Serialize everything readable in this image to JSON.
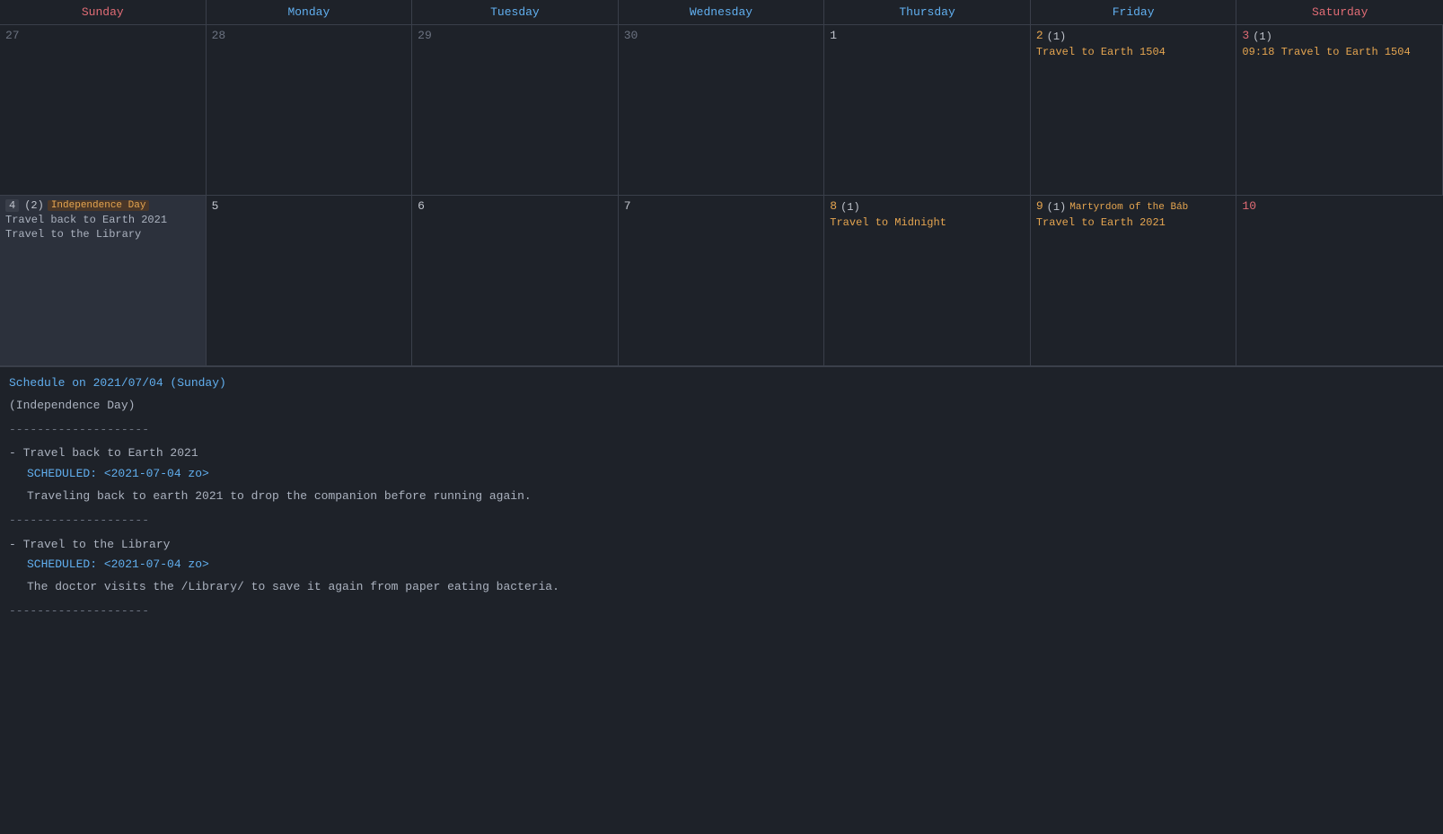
{
  "calendar": {
    "headers": [
      {
        "label": "Sunday",
        "class": "sun"
      },
      {
        "label": "Monday",
        "class": "mon"
      },
      {
        "label": "Tuesday",
        "class": "tue"
      },
      {
        "label": "Wednesday",
        "class": "wed"
      },
      {
        "label": "Thursday",
        "class": "thu"
      },
      {
        "label": "Friday",
        "class": "fri"
      },
      {
        "label": "Saturday",
        "class": "sat"
      }
    ],
    "weeks": [
      {
        "days": [
          {
            "date": "27",
            "type": "other-month",
            "events": []
          },
          {
            "date": "28",
            "type": "other-month",
            "events": []
          },
          {
            "date": "29",
            "type": "other-month",
            "events": []
          },
          {
            "date": "30",
            "type": "other-month",
            "events": []
          },
          {
            "date": "1",
            "type": "normal",
            "events": []
          },
          {
            "date": "2",
            "type": "orange",
            "count": "(1)",
            "events": [
              {
                "text": "Travel to Earth 1504",
                "color": "orange"
              }
            ]
          },
          {
            "date": "3",
            "type": "red",
            "count": "(1)",
            "events": [
              {
                "text": "09:18 Travel to Earth 1504",
                "color": "orange"
              }
            ]
          }
        ]
      },
      {
        "days": [
          {
            "date": "4",
            "type": "selected",
            "badge": "4",
            "count": "(2)",
            "holiday": "Independence Day",
            "events": [
              {
                "text": "Travel back to Earth 2021",
                "color": "gray"
              },
              {
                "text": "Travel to the Library",
                "color": "gray"
              }
            ]
          },
          {
            "date": "5",
            "type": "normal",
            "events": []
          },
          {
            "date": "6",
            "type": "normal",
            "events": []
          },
          {
            "date": "7",
            "type": "normal",
            "events": []
          },
          {
            "date": "8",
            "type": "orange",
            "count": "(1)",
            "events": [
              {
                "text": "Travel to Midnight",
                "color": "orange"
              }
            ]
          },
          {
            "date": "9",
            "type": "orange",
            "count": "(1)",
            "holiday": "Martyrdom of the Báb",
            "events": [
              {
                "text": "Travel to Earth 2021",
                "color": "orange"
              }
            ]
          },
          {
            "date": "10",
            "type": "red",
            "events": []
          }
        ]
      }
    ]
  },
  "schedule": {
    "header": "Schedule on 2021/07/04 (Sunday)",
    "holiday": "(Independence Day)",
    "divider": "--------------------",
    "tasks": [
      {
        "title": "- Travel back to Earth 2021",
        "scheduled": "SCHEDULED: <2021-07-04 zo>",
        "description": "Traveling back to earth 2021 to drop the companion before running again."
      },
      {
        "title": "- Travel to the Library",
        "scheduled": "SCHEDULED: <2021-07-04 zo>",
        "description": "The doctor visits the /Library/ to save it again from paper eating bacteria."
      }
    ]
  }
}
